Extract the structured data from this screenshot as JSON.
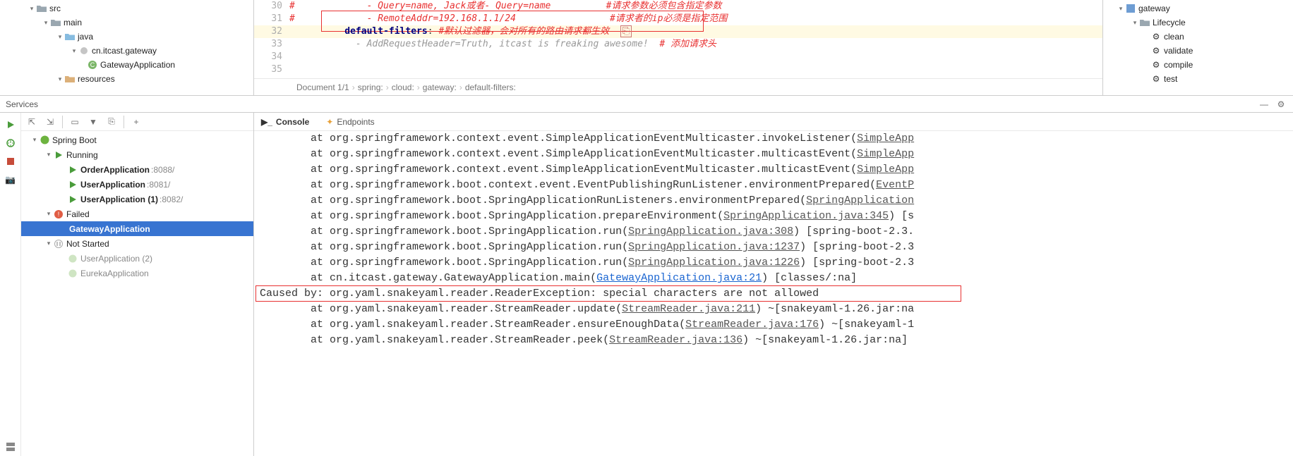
{
  "project_tree": {
    "src": "src",
    "main": "main",
    "java": "java",
    "pkg": "cn.itcast.gateway",
    "app": "GatewayApplication",
    "resources": "resources"
  },
  "editor": {
    "lines": {
      "l30n": "30",
      "l30": "#             - Query=name, Jack或者- Query=name          #请求参数必须包含指定参数",
      "l31n": "31",
      "l31": "#             - RemoteAddr=192.168.1.1/24                 #请求者的ip必须是指定范围",
      "l32n": "32",
      "l32_key": "default-filters",
      "l32_after": ": ",
      "l32_comment": "#默认过滤器，会对所有的路由请求都生效",
      "l33n": "33",
      "l33": "            - AddRequestHeader=Truth, itcast is freaking awesome!",
      "l33_comment": "# 添加请求头",
      "l34n": "34",
      "l35n": "35"
    },
    "breadcrumb": {
      "doc": "Document 1/1",
      "b1": "spring:",
      "b2": "cloud:",
      "b3": "gateway:",
      "b4": "default-filters:"
    }
  },
  "right_tree": {
    "gateway": "gateway",
    "lifecycle": "Lifecycle",
    "clean": "clean",
    "validate": "validate",
    "compile": "compile",
    "test": "test"
  },
  "services": {
    "title": "Services",
    "spring_boot": "Spring Boot",
    "running": "Running",
    "order_app": "OrderApplication",
    "order_port": ":8088/",
    "user_app": "UserApplication",
    "user_port": ":8081/",
    "user_app1": "UserApplication (1)",
    "user_port1": ":8082/",
    "failed": "Failed",
    "gateway_app": "GatewayApplication",
    "not_started": "Not Started",
    "user_app2": "UserApplication (2)",
    "eureka_app": "EurekaApplication"
  },
  "console": {
    "tab_console": "Console",
    "tab_endpoints": "Endpoints",
    "lines": [
      {
        "pre": "        at org.springframework.context.event.SimpleApplicationEventMulticaster.invokeListener(",
        "link": "SimpleApp"
      },
      {
        "pre": "        at org.springframework.context.event.SimpleApplicationEventMulticaster.multicastEvent(",
        "link": "SimpleApp"
      },
      {
        "pre": "        at org.springframework.context.event.SimpleApplicationEventMulticaster.multicastEvent(",
        "link": "SimpleApp"
      },
      {
        "pre": "        at org.springframework.boot.context.event.EventPublishingRunListener.environmentPrepared(",
        "link": "EventP"
      },
      {
        "pre": "        at org.springframework.boot.SpringApplicationRunListeners.environmentPrepared(",
        "link": "SpringApplication"
      },
      {
        "pre": "        at org.springframework.boot.SpringApplication.prepareEnvironment(",
        "link": "SpringApplication.java:345",
        "post": ") [s"
      },
      {
        "pre": "        at org.springframework.boot.SpringApplication.run(",
        "link": "SpringApplication.java:308",
        "post": ") [spring-boot-2.3."
      },
      {
        "pre": "        at org.springframework.boot.SpringApplication.run(",
        "link": "SpringApplication.java:1237",
        "post": ") [spring-boot-2.3"
      },
      {
        "pre": "        at org.springframework.boot.SpringApplication.run(",
        "link": "SpringApplication.java:1226",
        "post": ") [spring-boot-2.3"
      },
      {
        "pre": "        at cn.itcast.gateway.GatewayApplication.main(",
        "link_blue": "GatewayApplication.java:21",
        "post": ") [classes/:na]"
      },
      {
        "cause": "Caused by: org.yaml.snakeyaml.reader.ReaderException: special characters are not allowed"
      },
      {
        "pre": "        at org.yaml.snakeyaml.reader.StreamReader.update(",
        "link": "StreamReader.java:211",
        "post": ") ~[snakeyaml-1.26.jar:na"
      },
      {
        "pre": "        at org.yaml.snakeyaml.reader.StreamReader.ensureEnoughData(",
        "link": "StreamReader.java:176",
        "post": ") ~[snakeyaml-1"
      },
      {
        "pre": "        at org.yaml.snakeyaml.reader.StreamReader.peek(",
        "link": "StreamReader.java:136",
        "post": ") ~[snakeyaml-1.26.jar:na]"
      }
    ]
  }
}
